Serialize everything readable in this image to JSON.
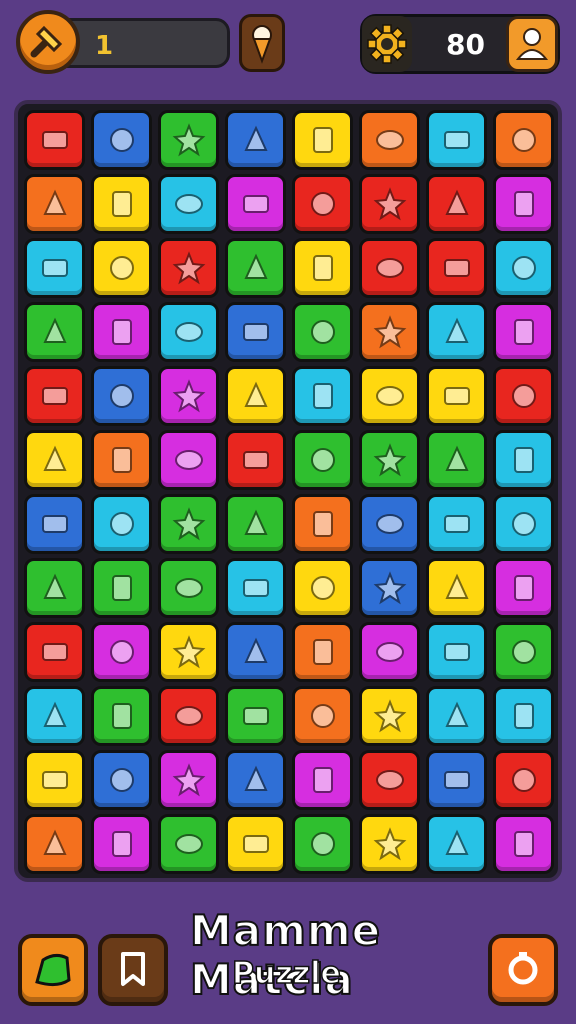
{
  "hud": {
    "moves_value": "1",
    "score_value": "80",
    "icons": {
      "hammer": "hammer-icon",
      "cone": "ice-cream-cone-icon",
      "gear": "gear-icon",
      "profile": "user-icon"
    }
  },
  "board": {
    "rows": 12,
    "cols": 8,
    "tiles": [
      [
        "red",
        "blue",
        "green",
        "blue",
        "yellow",
        "orange",
        "cyan",
        "orange"
      ],
      [
        "orange",
        "yellow",
        "cyan",
        "magenta",
        "red",
        "red",
        "red",
        "magenta"
      ],
      [
        "cyan",
        "yellow",
        "red",
        "green",
        "yellow",
        "red",
        "red",
        "cyan"
      ],
      [
        "green",
        "magenta",
        "cyan",
        "blue",
        "green",
        "orange",
        "cyan",
        "magenta"
      ],
      [
        "red",
        "blue",
        "magenta",
        "yellow",
        "cyan",
        "yellow",
        "yellow",
        "red"
      ],
      [
        "yellow",
        "orange",
        "magenta",
        "red",
        "green",
        "green",
        "green",
        "cyan"
      ],
      [
        "blue",
        "cyan",
        "green",
        "green",
        "orange",
        "blue",
        "cyan",
        "cyan"
      ],
      [
        "green",
        "green",
        "green",
        "cyan",
        "yellow",
        "blue",
        "yellow",
        "magenta"
      ],
      [
        "red",
        "magenta",
        "yellow",
        "blue",
        "orange",
        "magenta",
        "cyan",
        "green"
      ],
      [
        "cyan",
        "green",
        "red",
        "green",
        "orange",
        "yellow",
        "cyan",
        "cyan"
      ],
      [
        "yellow",
        "blue",
        "magenta",
        "blue",
        "magenta",
        "red",
        "blue",
        "red"
      ],
      [
        "orange",
        "magenta",
        "green",
        "yellow",
        "green",
        "yellow",
        "cyan",
        "magenta"
      ]
    ],
    "palette": {
      "red": "#e8261f",
      "orange": "#f4701e",
      "yellow": "#ffd80f",
      "green": "#2fbf2f",
      "cyan": "#27c2e6",
      "blue": "#2f6fd6",
      "magenta": "#d62ee0"
    }
  },
  "title": {
    "line1": "Mamme Matcla",
    "line2": "Puzzle"
  },
  "bottom_bar": {
    "icons": {
      "map": "map-icon",
      "bookmark": "bookmark-icon",
      "restart": "restart-icon"
    }
  },
  "colors": {
    "background": "#5a3c86",
    "accent_orange": "#f08a1c",
    "moves_text": "#f2c230"
  }
}
